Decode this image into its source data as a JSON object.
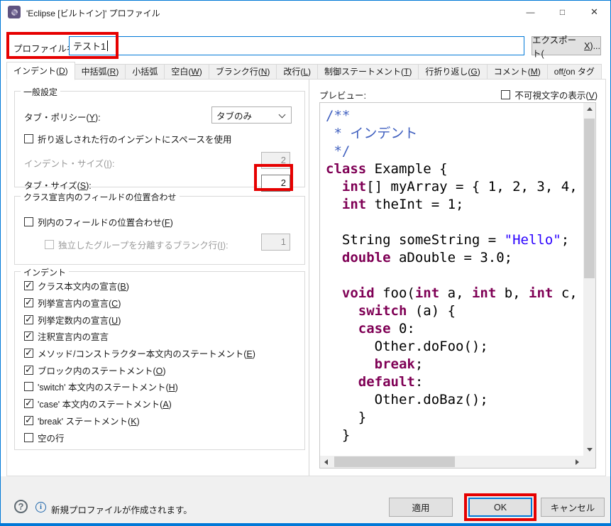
{
  "window": {
    "title": "'Eclipse [ビルトイン]' プロファイル",
    "controls": {
      "minimize": "—",
      "maximize": "□",
      "close": "✕"
    }
  },
  "profile": {
    "label": "プロファイル名(_P_):",
    "value": "テスト1",
    "export_label": "エクスポート(_X_)..."
  },
  "tabs": [
    "インデント(_D_)",
    "中括弧(_R_)",
    "小括弧",
    "空白(_W_)",
    "ブランク行(_N_)",
    "改行(_L_)",
    "制御ステートメント(_T_)",
    "行折り返し(_G_)",
    "コメント(_M_)",
    "off_/_on タグ"
  ],
  "active_tab": "インデント(D)",
  "general": {
    "legend": "一般設定",
    "tab_policy_label": "タブ・ポリシー(_Y_):",
    "tab_policy_value": "タブのみ",
    "wrap_checkbox_label": "折り返しされた行のインデントにスペースを使用",
    "wrap_checkbox_checked": false,
    "indent_size_label": "インデント・サイズ(_I_):",
    "indent_size_value": "2",
    "tab_size_label": "タブ・サイズ(_S_):",
    "tab_size_value": "2"
  },
  "alignment": {
    "legend": "クラス宣言内のフィールドの位置合わせ",
    "align_fields_label": "列内のフィールドの位置合わせ(_F_)",
    "align_fields_checked": false,
    "blank_lines_label": "独立したグループを分離するブランク行(_I_):",
    "blank_lines_checked": false,
    "blank_lines_value": "1"
  },
  "indent_group": {
    "legend": "インデント",
    "items": [
      {
        "label": "クラス本文内の宣言(_B_)",
        "checked": true
      },
      {
        "label": "列挙宣言内の宣言(_C_)",
        "checked": true
      },
      {
        "label": "列挙定数内の宣言(_U_)",
        "checked": true
      },
      {
        "label": "注釈宣言内の宣言",
        "checked": true
      },
      {
        "label": "メソッド/コンストラクター本文内のステートメント(_E_)",
        "checked": true
      },
      {
        "label": "ブロック内のステートメント(_O_)",
        "checked": true
      },
      {
        "label": "'switch' 本文内のステートメント(_H_)",
        "checked": false
      },
      {
        "label": "'case' 本文内のステートメント(_A_)",
        "checked": true
      },
      {
        "label": "'break' ステートメント(_K_)",
        "checked": true
      },
      {
        "label": "空の行",
        "checked": false
      }
    ]
  },
  "preview": {
    "label": "プレビュー:",
    "show_invisibles_label": "不可視文字の表示(_V_)",
    "show_invisibles_checked": false,
    "code_lines": [
      [
        [
          "c",
          "/**"
        ]
      ],
      [
        [
          "c",
          " * インデント"
        ]
      ],
      [
        [
          "c",
          " */"
        ]
      ],
      [
        [
          "k",
          "class"
        ],
        [
          "p",
          " Example {"
        ]
      ],
      [
        [
          "p",
          "  "
        ],
        [
          "k",
          "int"
        ],
        [
          "p",
          "[] myArray = { 1, 2, 3, 4,"
        ]
      ],
      [
        [
          "p",
          "  "
        ],
        [
          "k",
          "int"
        ],
        [
          "p",
          " theInt = 1;"
        ]
      ],
      [],
      [
        [
          "p",
          "  String someString = "
        ],
        [
          "s",
          "\"Hello\""
        ],
        [
          "p",
          ";"
        ]
      ],
      [
        [
          "p",
          "  "
        ],
        [
          "k",
          "double"
        ],
        [
          "p",
          " aDouble = 3.0;"
        ]
      ],
      [],
      [
        [
          "p",
          "  "
        ],
        [
          "k",
          "void"
        ],
        [
          "p",
          " foo("
        ],
        [
          "k",
          "int"
        ],
        [
          "p",
          " a, "
        ],
        [
          "k",
          "int"
        ],
        [
          "p",
          " b, "
        ],
        [
          "k",
          "int"
        ],
        [
          "p",
          " c,"
        ]
      ],
      [
        [
          "p",
          "    "
        ],
        [
          "k",
          "switch"
        ],
        [
          "p",
          " (a) {"
        ]
      ],
      [
        [
          "p",
          "    "
        ],
        [
          "k",
          "case"
        ],
        [
          "p",
          " 0:"
        ]
      ],
      [
        [
          "p",
          "      Other.doFoo();"
        ]
      ],
      [
        [
          "p",
          "      "
        ],
        [
          "k",
          "break"
        ],
        [
          "p",
          ";"
        ]
      ],
      [
        [
          "p",
          "    "
        ],
        [
          "k",
          "default"
        ],
        [
          "p",
          ":"
        ]
      ],
      [
        [
          "p",
          "      Other.doBaz();"
        ]
      ],
      [
        [
          "p",
          "    }"
        ]
      ],
      [
        [
          "p",
          "  }"
        ]
      ]
    ]
  },
  "footer": {
    "help_glyph": "?",
    "info_glyph": "i",
    "info_text": "新規プロファイルが作成されます。",
    "apply_label": "適用",
    "ok_label": "OK",
    "cancel_label": "キャンセル"
  },
  "colors": {
    "accent_blue": "#0078d7",
    "annotation_red": "#e60000",
    "keyword_purple": "#7f0055",
    "string_blue": "#2a00ff",
    "comment_blue": "#3f5fbf",
    "titlebar_icon_purple": "#5f5380"
  }
}
